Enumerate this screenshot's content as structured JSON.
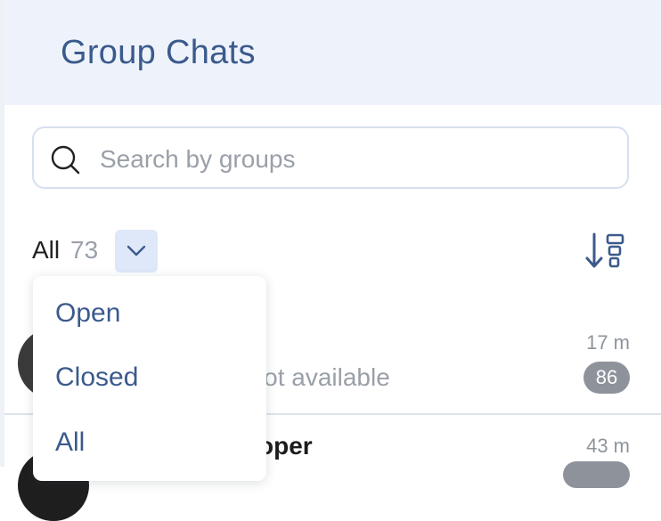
{
  "header": {
    "title": "Group Chats"
  },
  "search": {
    "placeholder": "Search by groups"
  },
  "filter": {
    "label": "All",
    "count": "73"
  },
  "dropdown": {
    "items": [
      "Open",
      "Closed",
      "All"
    ]
  },
  "chats": [
    {
      "preview_visible": "t not available",
      "time": "17 m",
      "unread": "86"
    },
    {
      "name_visible": "oper",
      "time": "43 m"
    }
  ],
  "colors": {
    "accent": "#3b5a8c",
    "header_bg": "#eef3fb",
    "badge": "#8e939b",
    "toggle_bg": "#dfe8f9"
  }
}
